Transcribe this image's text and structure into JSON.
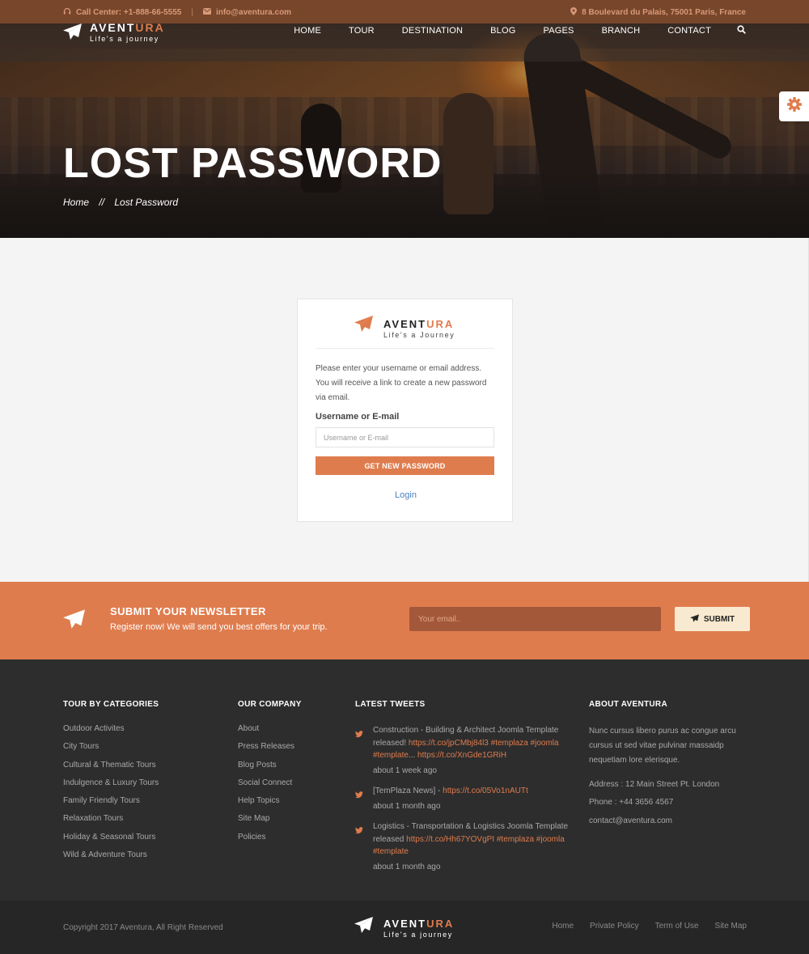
{
  "colors": {
    "accent": "#df7c4e",
    "topbar": "#7e4a2c",
    "footer": "#2d2d2d",
    "link_blue": "#4a7fc1"
  },
  "topbar": {
    "phone_icon": "headset-icon",
    "phone": "Call Center: +1-888-66-5555",
    "separator": "|",
    "email_icon": "envelope-icon",
    "email": "info@aventura.com",
    "address_icon": "map-marker-icon",
    "address": "8 Boulevard du Palais, 75001 Paris, France"
  },
  "brand": {
    "name_main": "AVENT",
    "name_accent": "URA",
    "tagline": "Life's a journey",
    "tagline_card": "Life's a Journey"
  },
  "nav": {
    "items": [
      "HOME",
      "TOUR",
      "DESTINATION",
      "BLOG",
      "PAGES",
      "BRANCH",
      "CONTACT"
    ],
    "search_icon": "search-icon"
  },
  "hero": {
    "title": "LOST PASSWORD",
    "breadcrumb_home": "Home",
    "breadcrumb_divider": "//",
    "breadcrumb_current": "Lost Password"
  },
  "settings": {
    "icon": "gear-icon"
  },
  "card": {
    "instructions": "Please enter your username or email address. You will receive a link to create a new password via email.",
    "field_label": "Username or E-mail",
    "field_placeholder": "Username or E-mail",
    "button": "GET NEW PASSWORD",
    "login_link": "Login"
  },
  "newsletter": {
    "title": "SUBMIT YOUR NEWSLETTER",
    "subtitle": "Register now! We will send you best offers for your trip.",
    "placeholder": "Your email..",
    "button": "SUBMIT"
  },
  "footer": {
    "categories": {
      "title": "TOUR BY CATEGORIES",
      "items": [
        "Outdoor Activites",
        "City Tours",
        "Cultural & Thematic Tours",
        "Indulgence & Luxury Tours",
        "Family Friendly Tours",
        "Relaxation Tours",
        "Holiday & Seasonal Tours",
        "Wild & Adventure Tours"
      ]
    },
    "company": {
      "title": "OUR COMPANY",
      "items": [
        "About",
        "Press Releases",
        "Blog Posts",
        "Social Connect",
        "Help Topics",
        "Site Map",
        "Policies"
      ]
    },
    "tweets": {
      "title": "LATEST TWEETS",
      "items": [
        {
          "text1": "Construction - Building & Architect Joomla Template released! ",
          "link1": "https://t.co/jpCMbj84l3 #templaza #joomla #template",
          "text2": "... ",
          "link2": "https://t.co/XnGde1GRiH",
          "ago": "about 1 week ago"
        },
        {
          "text1": "[TemPlaza News] - ",
          "link1": "https://t.co/05Vo1nAUTt",
          "text2": "",
          "link2": "",
          "ago": "about 1 month ago"
        },
        {
          "text1": "Logistics - Transportation & Logistics Joomla Template released ",
          "link1": "https://t.co/Hh67YOVgPI #templaza #joomla #template",
          "text2": "",
          "link2": "",
          "ago": "about 1 month ago"
        }
      ]
    },
    "about": {
      "title": "ABOUT AVENTURA",
      "text": "Nunc cursus libero purus ac congue arcu cursus ut sed vitae pulvinar massaidp nequetiam lore elerisque.",
      "address": "Address : 12 Main Street Pt. London",
      "phone": "Phone : +44 3656 4567",
      "email": "contact@aventura.com"
    }
  },
  "bottom": {
    "copyright": "Copyright 2017 Aventura, All Right Reserved",
    "links": [
      "Home",
      "Private Policy",
      "Term of Use",
      "Site Map"
    ]
  }
}
